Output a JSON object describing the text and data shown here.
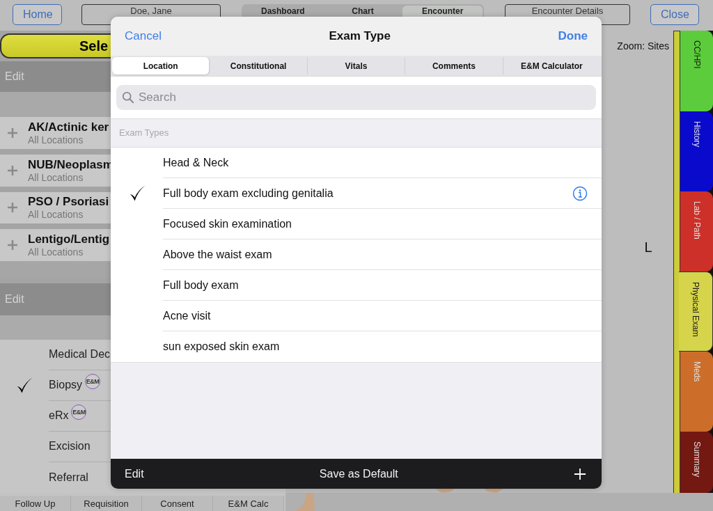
{
  "top_bar": {
    "home": "Home",
    "patient": "Doe, Jane",
    "views": [
      {
        "label": "Dashboard",
        "selected": false
      },
      {
        "label": "Chart",
        "selected": false
      },
      {
        "label": "Encounter",
        "selected": true
      }
    ],
    "details": "Encounter Details",
    "close": "Close"
  },
  "left_panel": {
    "header": "Sele",
    "edit_top": "Edit",
    "diagnoses": [
      {
        "name": "AK/Actinic ker",
        "sub": "All Locations"
      },
      {
        "name": "NUB/Neoplasm",
        "sub": "All Locations"
      },
      {
        "name": "PSO / Psoriasi",
        "sub": "All Locations"
      },
      {
        "name": "Lentigo/Lentig",
        "sub": "All Locations"
      }
    ],
    "edit_bottom": "Edit",
    "procedures": [
      {
        "label": "Medical Dec",
        "checked": false
      },
      {
        "label": "Biopsy",
        "checked": true,
        "badge": "E&M"
      },
      {
        "label": "eRx",
        "checked": false,
        "badge": "E&M"
      },
      {
        "label": "Excision",
        "checked": false
      },
      {
        "label": "Referral",
        "checked": false
      }
    ]
  },
  "bottom_tabs": [
    "Follow Up",
    "Requisition",
    "Consent",
    "E&M Calc"
  ],
  "canvas": {
    "zoom_label": "Zoom: Sites",
    "side_label": "L"
  },
  "side_tabs": [
    {
      "label": "CC/HPI",
      "color": "#5ccc3c",
      "selected": false
    },
    {
      "label": "History",
      "color": "#0a0acc",
      "selected": false
    },
    {
      "label": "Lab / Path",
      "color": "#cc3028",
      "selected": false
    },
    {
      "label": "Physical Exam",
      "color": "#d6d44a",
      "selected": true
    },
    {
      "label": "Meds",
      "color": "#cc6e2a",
      "selected": false
    },
    {
      "label": "Summary",
      "color": "#741812",
      "selected": false
    }
  ],
  "modal": {
    "cancel": "Cancel",
    "title": "Exam Type",
    "done": "Done",
    "tabs": [
      {
        "label": "Location",
        "selected": true
      },
      {
        "label": "Constitutional",
        "selected": false
      },
      {
        "label": "Vitals",
        "selected": false
      },
      {
        "label": "Comments",
        "selected": false
      },
      {
        "label": "E&M Calculator",
        "selected": false
      }
    ],
    "search_placeholder": "Search",
    "section": "Exam Types",
    "items": [
      {
        "label": "Head & Neck",
        "checked": false,
        "info": false
      },
      {
        "label": "Full body exam excluding genitalia",
        "checked": true,
        "info": true
      },
      {
        "label": "Focused skin examination",
        "checked": false,
        "info": false
      },
      {
        "label": "Above the waist exam",
        "checked": false,
        "info": false
      },
      {
        "label": "Full body exam",
        "checked": false,
        "info": false
      },
      {
        "label": "Acne visit",
        "checked": false,
        "info": false
      },
      {
        "label": "sun exposed skin exam",
        "checked": false,
        "info": false
      }
    ],
    "footer": {
      "edit": "Edit",
      "save": "Save as Default"
    }
  }
}
